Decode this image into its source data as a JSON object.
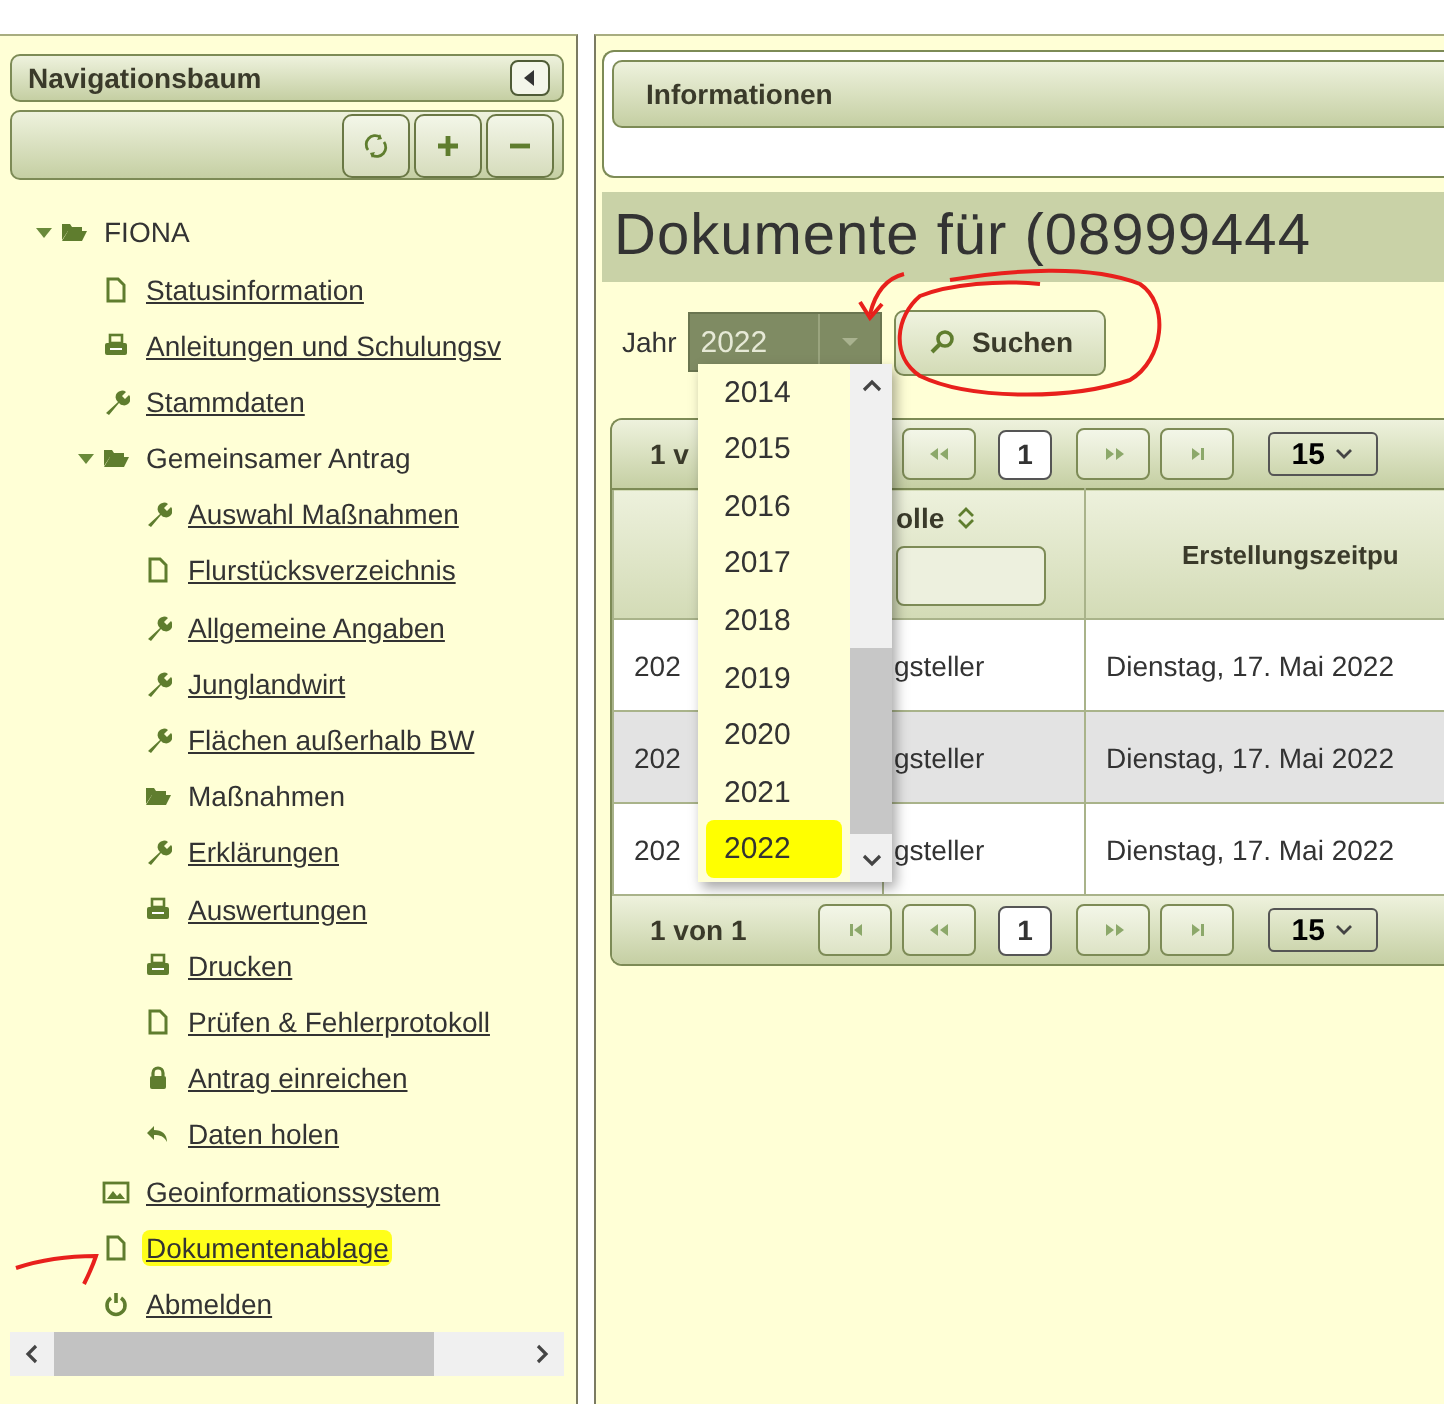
{
  "navigation": {
    "title": "Navigationsbaum",
    "tree": [
      {
        "label": "FIONA",
        "kind": "folder",
        "link": false,
        "highlighted": false,
        "expanded": true,
        "children": [
          {
            "label": "Statusinformation",
            "kind": "page",
            "link": true,
            "highlighted": false
          },
          {
            "label": "Anleitungen und Schulungsv",
            "kind": "printer",
            "link": true,
            "highlighted": false
          },
          {
            "label": "Stammdaten",
            "kind": "wrench",
            "link": true,
            "highlighted": false
          },
          {
            "label": "Gemeinsamer Antrag",
            "kind": "folder",
            "link": false,
            "highlighted": false,
            "expanded": true,
            "children": [
              {
                "label": "Auswahl Maßnahmen",
                "kind": "wrench",
                "link": true,
                "highlighted": false
              },
              {
                "label": "Flurstücksverzeichnis",
                "kind": "page",
                "link": true,
                "highlighted": false
              },
              {
                "label": "Allgemeine Angaben",
                "kind": "wrench",
                "link": true,
                "highlighted": false
              },
              {
                "label": "Junglandwirt",
                "kind": "wrench",
                "link": true,
                "highlighted": false
              },
              {
                "label": "Flächen außerhalb BW",
                "kind": "wrench",
                "link": true,
                "highlighted": false
              },
              {
                "label": "Maßnahmen",
                "kind": "folder",
                "link": false,
                "highlighted": false
              },
              {
                "label": "Erklärungen",
                "kind": "wrench",
                "link": true,
                "highlighted": false
              },
              {
                "label": "Auswertungen",
                "kind": "printer",
                "link": true,
                "highlighted": false
              },
              {
                "label": "Drucken",
                "kind": "printer",
                "link": true,
                "highlighted": false
              },
              {
                "label": "Prüfen & Fehlerprotokoll",
                "kind": "page",
                "link": true,
                "highlighted": false
              },
              {
                "label": "Antrag einreichen",
                "kind": "lock",
                "link": true,
                "highlighted": false
              },
              {
                "label": "Daten holen",
                "kind": "back",
                "link": true,
                "highlighted": false
              }
            ]
          },
          {
            "label": "Geoinformationssystem",
            "kind": "image",
            "link": true,
            "highlighted": false
          },
          {
            "label": "Dokumentenablage",
            "kind": "page",
            "link": true,
            "highlighted": true
          },
          {
            "label": "Abmelden",
            "kind": "power",
            "link": true,
            "highlighted": false
          }
        ]
      }
    ]
  },
  "main": {
    "panel_title": "Informationen",
    "heading": "Dokumente für (08999444",
    "year_filter": {
      "label": "Jahr",
      "value": "2022",
      "options": [
        {
          "label": "2014",
          "selected": false
        },
        {
          "label": "2015",
          "selected": false
        },
        {
          "label": "2016",
          "selected": false
        },
        {
          "label": "2017",
          "selected": false
        },
        {
          "label": "2018",
          "selected": false
        },
        {
          "label": "2019",
          "selected": false
        },
        {
          "label": "2020",
          "selected": false
        },
        {
          "label": "2021",
          "selected": false
        },
        {
          "label": "2022",
          "selected": true
        }
      ]
    },
    "search_button": "Suchen",
    "table": {
      "top_pager": {
        "label": "1 v",
        "page": "1",
        "page_size": "15",
        "buttons": [
          {
            "kind": "prev"
          },
          {
            "kind": "next"
          },
          {
            "kind": "last"
          }
        ]
      },
      "columns": [
        {
          "kind": "blank"
        },
        {
          "kind": "sort_filter",
          "label": "olle"
        },
        {
          "kind": "plain",
          "label": "Erstellungszeitpu"
        }
      ],
      "rows": [
        [
          "202",
          "gsteller",
          "Dienstag, 17. Mai 2022"
        ],
        [
          "202",
          "gsteller",
          "Dienstag, 17. Mai 2022"
        ],
        [
          "202",
          "gsteller",
          "Dienstag, 17. Mai 2022"
        ]
      ],
      "bottom_pager": {
        "label": "1 von 1",
        "page": "1",
        "page_size": "15",
        "buttons": [
          {
            "kind": "first"
          },
          {
            "kind": "prev"
          },
          {
            "kind": "next"
          },
          {
            "kind": "last"
          }
        ]
      }
    }
  }
}
